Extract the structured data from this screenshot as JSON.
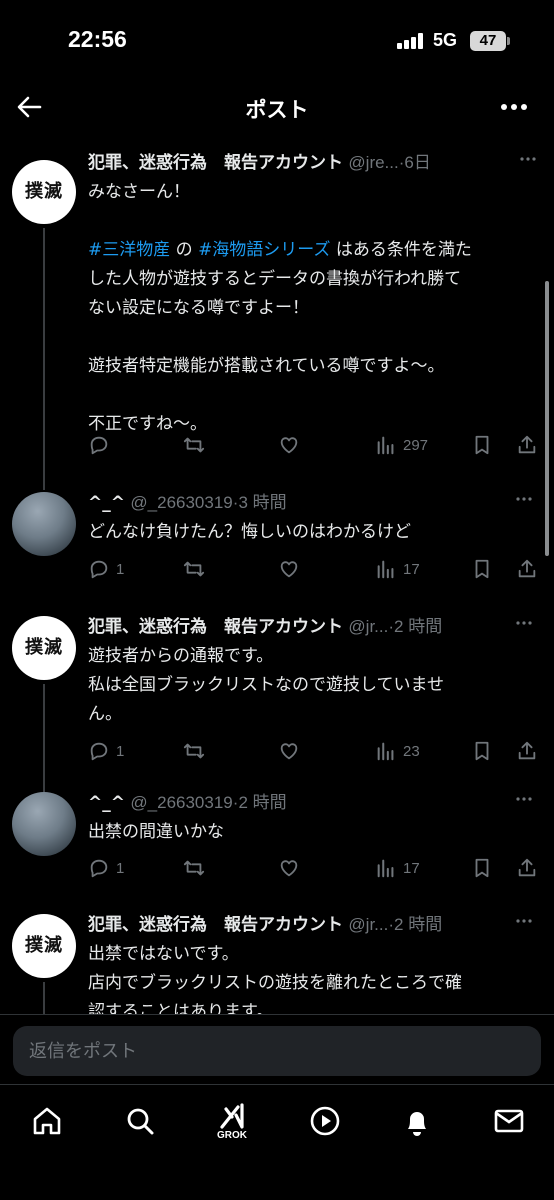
{
  "status_bar": {
    "time": "22:56",
    "network": "5G",
    "battery": "47"
  },
  "header": {
    "title": "ポスト"
  },
  "posts": [
    {
      "avatar_text": "撲滅",
      "name": "犯罪、迷惑行為　報告アカウント",
      "handle": "@jre...",
      "time": "6日",
      "lines": [
        "みなさーん！"
      ],
      "hashtag_line": {
        "tag1": "#三洋物産",
        "mid": " の ",
        "tag2": "#海物語シリーズ",
        "rest": " はある条件を満た"
      },
      "lines2": [
        "した人物が遊技するとデータの書換が行われ勝て",
        "ない設定になる噂ですよー！"
      ],
      "lines3": [
        "遊技者特定機能が搭載されている噂ですよ〜。"
      ],
      "lines4": [
        "不正ですね〜。"
      ],
      "views": "297"
    },
    {
      "name": "^_^",
      "handle": "@_26630319",
      "time": "3 時間",
      "lines": [
        "どんなけ負けたん？悔しいのはわかるけど"
      ],
      "replies": "1",
      "views": "17"
    },
    {
      "avatar_text": "撲滅",
      "name": "犯罪、迷惑行為　報告アカウント",
      "handle": "@jr...",
      "time": "2 時間",
      "lines": [
        "遊技者からの通報です。",
        "私は全国ブラックリストなので遊技していませ",
        "ん。"
      ],
      "replies": "1",
      "views": "23"
    },
    {
      "name": "^_^",
      "handle": "@_26630319",
      "time": "2 時間",
      "lines": [
        "出禁の間違いかな"
      ],
      "replies": "1",
      "views": "17"
    },
    {
      "avatar_text": "撲滅",
      "name": "犯罪、迷惑行為　報告アカウント",
      "handle": "@jr...",
      "time": "2 時間",
      "lines": [
        "出禁ではないです。",
        "店内でブラックリストの遊技を離れたところで確",
        "認することはあります。"
      ]
    }
  ],
  "reply": {
    "placeholder": "返信をポスト"
  },
  "nav": {
    "grok_label": "GROK"
  },
  "icons": [
    "back-arrow-icon",
    "more-icon",
    "reply-icon",
    "repost-icon",
    "like-icon",
    "views-icon",
    "bookmark-icon",
    "share-icon",
    "home-icon",
    "search-icon",
    "grok-icon",
    "video-icon",
    "bell-icon",
    "mail-icon"
  ],
  "colors": {
    "background": "#000000",
    "text": "#e7e9ea",
    "muted": "#71767b",
    "link": "#1d9bf0",
    "avatar_badge": "#ffffff"
  }
}
